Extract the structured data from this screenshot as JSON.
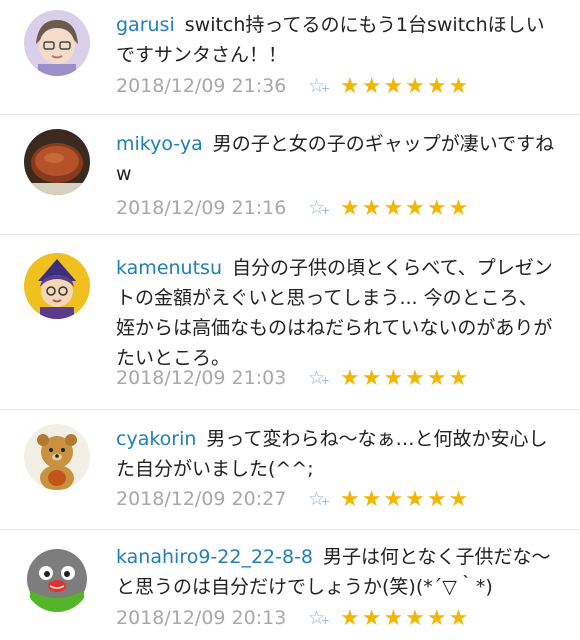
{
  "comments": [
    {
      "username": "garusi",
      "text": "switch持ってるのにもう1台switchほしいですサンタさん！！",
      "timestamp": "2018/12/09 21:36",
      "star_count": 6,
      "avatar_icon": "avatar-garusi-icon"
    },
    {
      "username": "mikyo-ya",
      "text": "男の子と女の子のギャップが凄いですねw",
      "timestamp": "2018/12/09 21:16",
      "star_count": 6,
      "avatar_icon": "avatar-mikyo-ya-icon"
    },
    {
      "username": "kamenutsu",
      "text": "自分の子供の頃とくらべて、プレゼントの金額がえぐいと思ってしまう... 今のところ、姪からは高価なものはねだられていないのがありがたいところ。",
      "timestamp": "2018/12/09 21:03",
      "star_count": 6,
      "avatar_icon": "avatar-kamenutsu-icon"
    },
    {
      "username": "cyakorin",
      "text": "男って変わらね〜なぁ…と何故か安心した自分がいました(^^;",
      "timestamp": "2018/12/09 20:27",
      "star_count": 6,
      "avatar_icon": "avatar-cyakorin-icon"
    },
    {
      "username": "kanahiro9-22_22-8-8",
      "text": "男子は何となく子供だな〜と思うのは自分だけでしょうか(笑)(*´▽｀*)",
      "timestamp": "2018/12/09 20:13",
      "star_count": 6,
      "avatar_icon": "avatar-kanahiro-icon"
    }
  ],
  "colors": {
    "username": "#1f7fb8",
    "timestamp": "#a8a8a8",
    "star": "#f2b705",
    "add_star": "#8fb8e0"
  },
  "icons": {
    "star": "★",
    "add_star": "☆"
  }
}
